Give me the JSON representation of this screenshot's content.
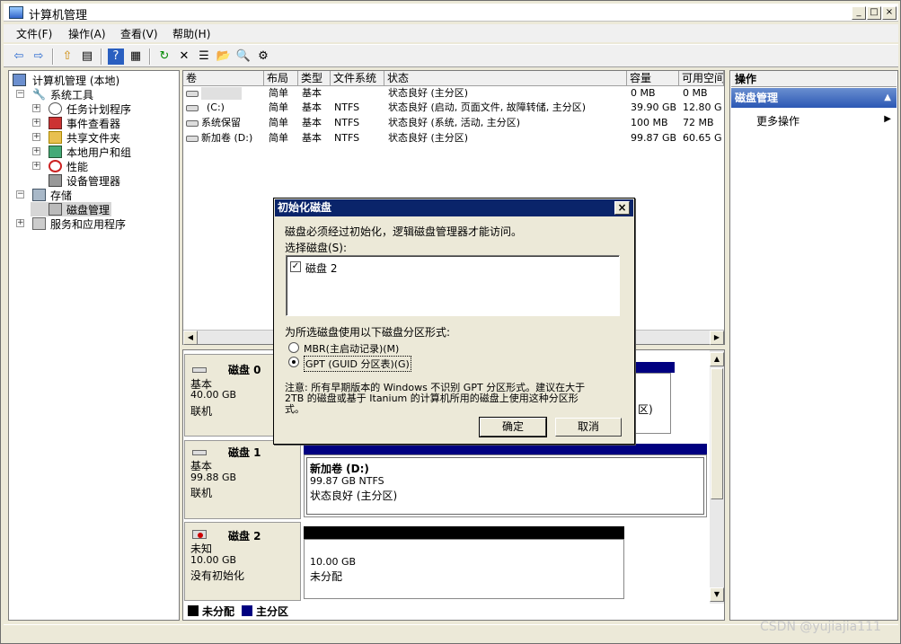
{
  "window": {
    "title": "计算机管理",
    "min": "_",
    "max": "□",
    "close": "×"
  },
  "menu": {
    "items": [
      "文件(F)",
      "操作(A)",
      "查看(V)",
      "帮助(H)"
    ]
  },
  "toolbar": {
    "back": "⇦",
    "forward": "⇨",
    "up": "⇧",
    "show": "▤",
    "help": "?",
    "view": "▦",
    "refresh": "↻",
    "delete": "✕",
    "properties": "☰",
    "open": "📂",
    "search": "🔍",
    "wizard": "⚙"
  },
  "tree": {
    "root": "计算机管理 (本地)",
    "items": [
      {
        "label": "系统工具",
        "expander": "−"
      },
      {
        "label": "任务计划程序",
        "expander": "+"
      },
      {
        "label": "事件查看器",
        "expander": "+"
      },
      {
        "label": "共享文件夹",
        "expander": "+"
      },
      {
        "label": "本地用户和组",
        "expander": "+"
      },
      {
        "label": "性能",
        "expander": "+"
      },
      {
        "label": "设备管理器",
        "expander": ""
      },
      {
        "label": "存储",
        "expander": "−"
      },
      {
        "label": "磁盘管理",
        "expander": ""
      },
      {
        "label": "服务和应用程序",
        "expander": "+"
      }
    ]
  },
  "volumes": {
    "headers": [
      "卷",
      "布局",
      "类型",
      "文件系统",
      "状态",
      "容量",
      "可用空间"
    ],
    "rows": [
      [
        "",
        "简单",
        "基本",
        "",
        "状态良好 (主分区)",
        "0 MB",
        "0 MB"
      ],
      [
        "(C:)",
        "简单",
        "基本",
        "NTFS",
        "状态良好 (启动, 页面文件, 故障转储, 主分区)",
        "39.90 GB",
        "12.80 G"
      ],
      [
        "系统保留",
        "简单",
        "基本",
        "NTFS",
        "状态良好 (系统, 活动, 主分区)",
        "100 MB",
        "72 MB"
      ],
      [
        "新加卷 (D:)",
        "简单",
        "基本",
        "NTFS",
        "状态良好 (主分区)",
        "99.87 GB",
        "60.65 G"
      ]
    ]
  },
  "disks": [
    {
      "name": "磁盘 0",
      "type": "基本",
      "size": "40.00 GB",
      "state": "联机",
      "partial": "区)"
    },
    {
      "name": "磁盘 1",
      "type": "基本",
      "size": "99.88 GB",
      "state": "联机",
      "vol_name": "新加卷  (D:)",
      "vol_size": "99.87 GB NTFS",
      "vol_status": "状态良好 (主分区)"
    },
    {
      "name": "磁盘 2",
      "type": "未知",
      "size": "10.00 GB",
      "state": "没有初始化",
      "vol_size": "10.00 GB",
      "vol_status": "未分配"
    }
  ],
  "legend": {
    "unallocated": "未分配",
    "primary": "主分区",
    "unallocated_color": "#000000",
    "primary_color": "#000080"
  },
  "actions": {
    "header": "操作",
    "selected": "磁盘管理",
    "more": "更多操作",
    "more_arrow": "▶",
    "collapse_arrow": "▲"
  },
  "dialog": {
    "title": "初始化磁盘",
    "close": "×",
    "intro": "磁盘必须经过初始化，逻辑磁盘管理器才能访问。",
    "select_label": "选择磁盘(S):",
    "disk_item": "磁盘 2",
    "check_mark": "✓",
    "style_label": "为所选磁盘使用以下磁盘分区形式:",
    "mbr": "MBR(主启动记录)(M)",
    "gpt": "GPT (GUID 分区表)(G)",
    "note1": "注意: 所有早期版本的 Windows 不识别 GPT 分区形式。建议在大于",
    "note2": "2TB 的磁盘或基于 Itanium 的计算机所用的磁盘上使用这种分区形",
    "note3": "式。",
    "ok": "确定",
    "cancel": "取消"
  },
  "watermark": "CSDN @yujiajia111"
}
